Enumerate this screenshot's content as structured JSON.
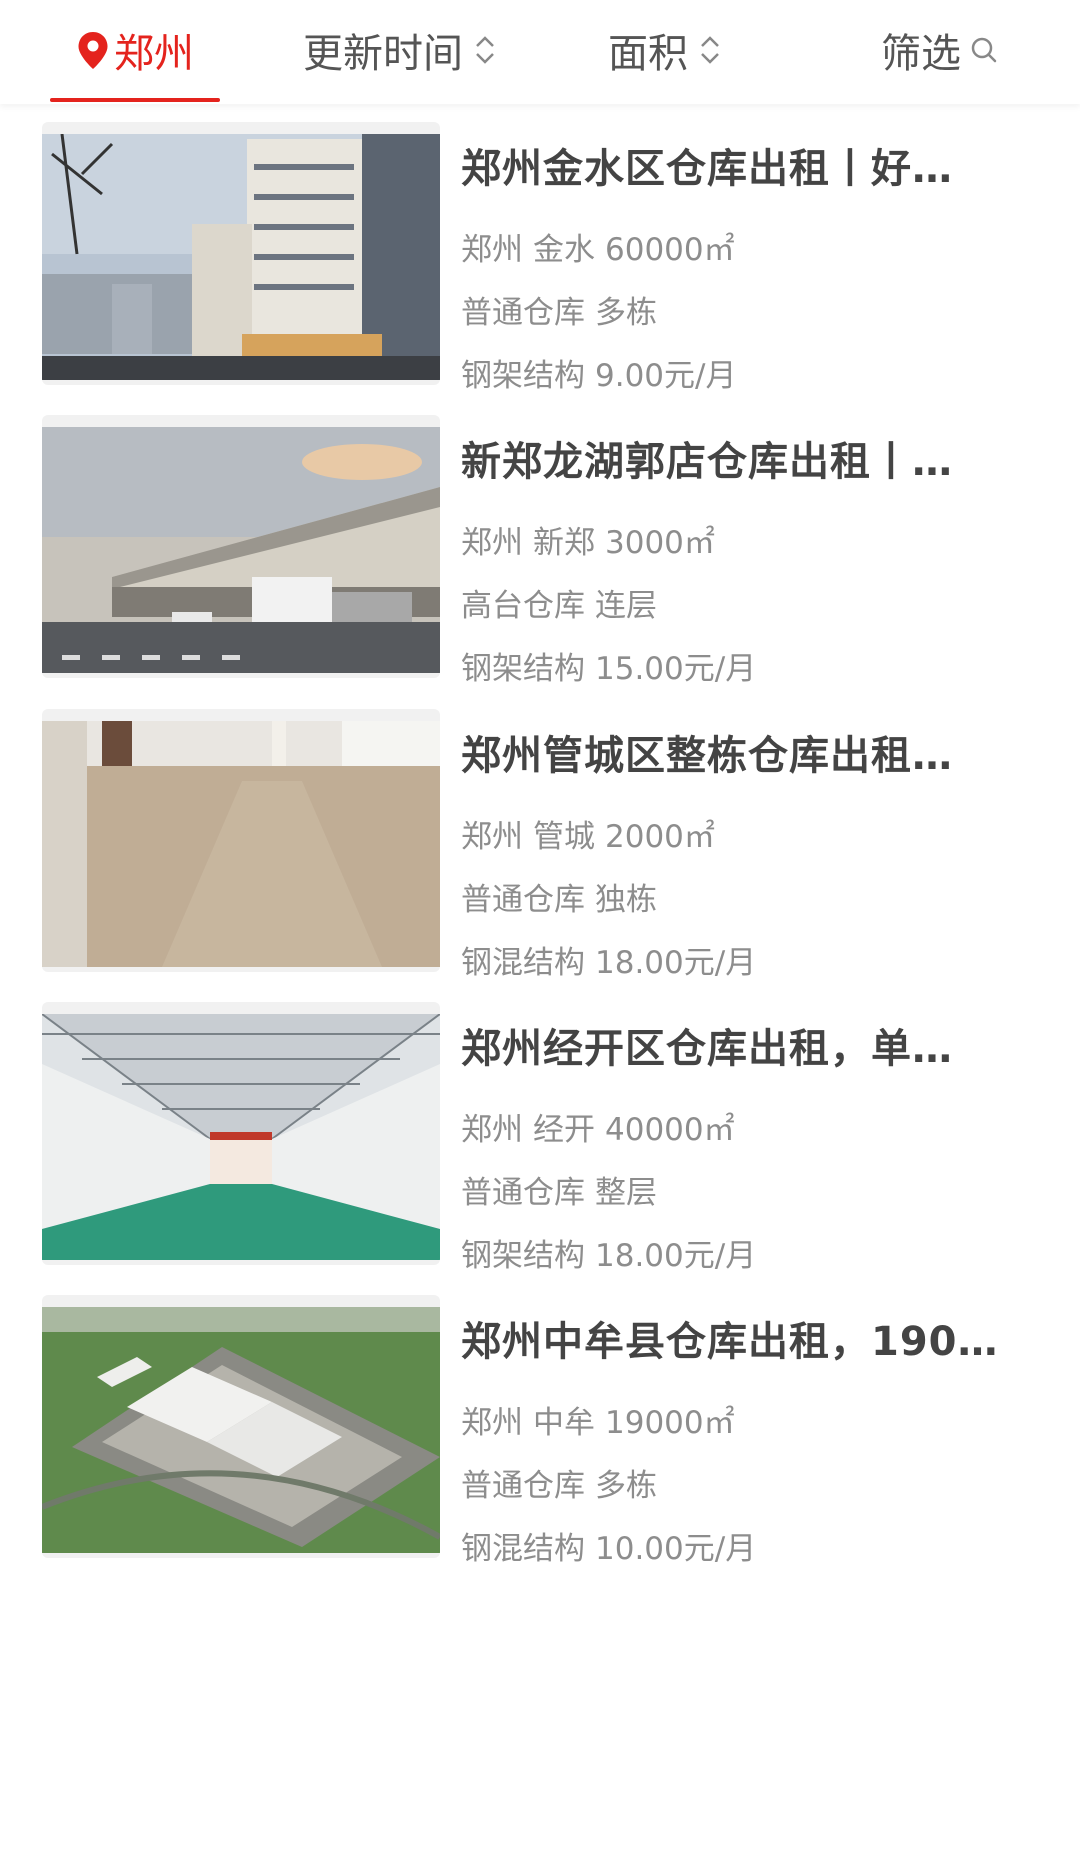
{
  "filter_bar": {
    "city": "郑州",
    "update_time": "更新时间",
    "area": "面积",
    "filter": "筛选"
  },
  "listings": [
    {
      "title": "郑州金水区仓库出租丨好…",
      "city": "郑州",
      "district": "金水",
      "area": "60000㎡",
      "type": "普通仓库",
      "floors": "多栋",
      "structure": "钢架结构",
      "price": "9.00元/月",
      "image": "multi-story-warehouse-building-photo"
    },
    {
      "title": "新郑龙湖郭店仓库出租丨…",
      "city": "郑州",
      "district": "新郑",
      "area": "3000㎡",
      "type": "高台仓库",
      "floors": "连层",
      "structure": "钢架结构",
      "price": "15.00元/月",
      "image": "loading-dock-warehouse-with-trucks-photo"
    },
    {
      "title": "郑州管城区整栋仓库出租…",
      "city": "郑州",
      "district": "管城",
      "area": "2000㎡",
      "type": "普通仓库",
      "floors": "独栋",
      "structure": "钢混结构",
      "price": "18.00元/月",
      "image": "empty-interior-floor-photo"
    },
    {
      "title": "郑州经开区仓库出租，单…",
      "city": "郑州",
      "district": "经开",
      "area": "40000㎡",
      "type": "普通仓库",
      "floors": "整层",
      "structure": "钢架结构",
      "price": "18.00元/月",
      "image": "steel-frame-warehouse-interior-photo"
    },
    {
      "title": "郑州中牟县仓库出租，190…",
      "city": "郑州",
      "district": "中牟",
      "area": "19000㎡",
      "type": "普通仓库",
      "floors": "多栋",
      "structure": "钢混结构",
      "price": "10.00元/月",
      "image": "aerial-warehouse-complex-rendering"
    }
  ],
  "colors": {
    "accent": "#e4231d",
    "title": "#444444",
    "meta": "#8d8d8d"
  }
}
